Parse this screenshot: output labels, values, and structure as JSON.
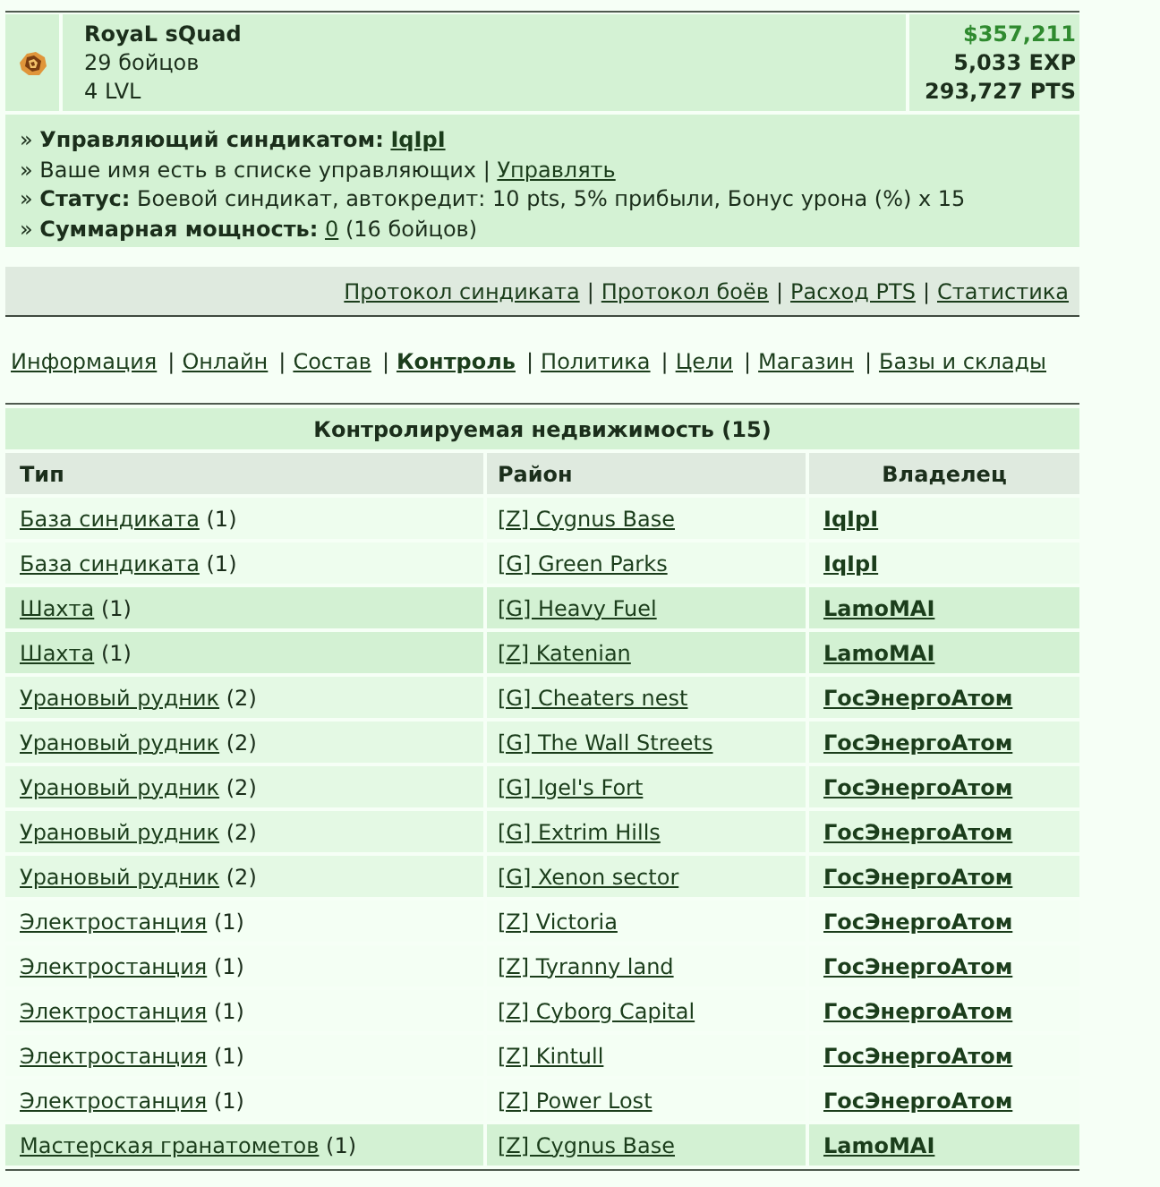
{
  "header": {
    "name": "RoyaL sQuad",
    "members": "29 бойцов",
    "level": "4 LVL",
    "money": "$357,211",
    "exp": "5,033 EXP",
    "pts": "293,727 PTS"
  },
  "info": [
    {
      "parts": [
        {
          "kind": "text",
          "text": "» **Управляющий синдикатом:**"
        },
        {
          "kind": "bold-link",
          "text": "IqIpI"
        }
      ]
    },
    {
      "parts": [
        {
          "kind": "text",
          "text": "» Ваше имя есть в списке управляющих |"
        },
        {
          "kind": "link",
          "text": "Управлять"
        }
      ]
    },
    {
      "parts": [
        {
          "kind": "text",
          "text": "» **Статус:** Боевой синдикат, автокредит: 10 pts, 5% прибыли, Бонус урона (%) x 15"
        }
      ]
    },
    {
      "parts": [
        {
          "kind": "text",
          "text": "» **Суммарная мощность:**"
        },
        {
          "kind": "link",
          "text": "0"
        },
        {
          "kind": "text",
          "text": "(16 бойцов)"
        }
      ]
    }
  ],
  "links": {
    "separator": "|",
    "items": [
      "Протокол синдиката",
      "Протокол боёв",
      "Расход PTS",
      "Статистика"
    ]
  },
  "nav": {
    "separator": "|",
    "tabs": [
      {
        "label": "Информация",
        "selected": false
      },
      {
        "label": "Онлайн",
        "selected": false
      },
      {
        "label": "Состав",
        "selected": false
      },
      {
        "label": "Контроль",
        "selected": true
      },
      {
        "label": "Политика",
        "selected": false
      },
      {
        "label": "Цели",
        "selected": false
      },
      {
        "label": "Магазин",
        "selected": false
      },
      {
        "label": "Базы и склады",
        "selected": false
      }
    ]
  },
  "table": {
    "title": "Контролируемая недвижимость (15)",
    "columns": [
      "Тип",
      "Район",
      "Владелец"
    ],
    "rows": [
      {
        "type": "База синдиката",
        "count": "(1)",
        "district": "[Z] Cygnus Base",
        "owner": "IqIpI",
        "color": "#eefdee"
      },
      {
        "type": "База синдиката",
        "count": "(1)",
        "district": "[G] Green Parks",
        "owner": "IqIpI",
        "color": "#eefdee"
      },
      {
        "type": "Шахта",
        "count": "(1)",
        "district": "[G] Heavy Fuel",
        "owner": "LamoMAI",
        "color": "#d3f1d3"
      },
      {
        "type": "Шахта",
        "count": "(1)",
        "district": "[Z] Katenian",
        "owner": "LamoMAI",
        "color": "#d3f1d3"
      },
      {
        "type": "Урановый рудник",
        "count": "(2)",
        "district": "[G] Cheaters nest",
        "owner": "ГосЭнергоАтом",
        "color": "#e4f9e4"
      },
      {
        "type": "Урановый рудник",
        "count": "(2)",
        "district": "[G] The Wall Streets",
        "owner": "ГосЭнергоАтом",
        "color": "#e4f9e4"
      },
      {
        "type": "Урановый рудник",
        "count": "(2)",
        "district": "[G] Igel's Fort",
        "owner": "ГосЭнергоАтом",
        "color": "#e4f9e4"
      },
      {
        "type": "Урановый рудник",
        "count": "(2)",
        "district": "[G] Extrim Hills",
        "owner": "ГосЭнергоАтом",
        "color": "#e4f9e4"
      },
      {
        "type": "Урановый рудник",
        "count": "(2)",
        "district": "[G] Xenon sector",
        "owner": "ГосЭнергоАтом",
        "color": "#e4f9e4"
      },
      {
        "type": "Электростанция",
        "count": "(1)",
        "district": "[Z] Victoria",
        "owner": "ГосЭнергоАтом",
        "color": "#f4fff4"
      },
      {
        "type": "Электростанция",
        "count": "(1)",
        "district": "[Z] Tyranny land",
        "owner": "ГосЭнергоАтом",
        "color": "#f4fff4"
      },
      {
        "type": "Электростанция",
        "count": "(1)",
        "district": "[Z] Cyborg Capital",
        "owner": "ГосЭнергоАтом",
        "color": "#f4fff4"
      },
      {
        "type": "Электростанция",
        "count": "(1)",
        "district": "[Z] Kintull",
        "owner": "ГосЭнергоАтом",
        "color": "#f4fff4"
      },
      {
        "type": "Электростанция",
        "count": "(1)",
        "district": "[Z] Power Lost",
        "owner": "ГосЭнергоАтом",
        "color": "#f4fff4"
      },
      {
        "type": "Мастерская гранатометов",
        "count": "(1)",
        "district": "[Z] Cygnus Base",
        "owner": "LamoMAI",
        "color": "#d3f1d3"
      }
    ]
  }
}
